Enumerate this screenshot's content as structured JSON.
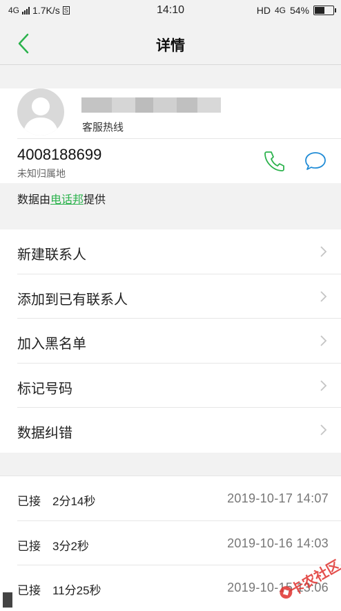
{
  "status_bar": {
    "network": "4G",
    "speed": "1.7K/s",
    "time": "14:10",
    "hd": "HD",
    "network_right": "4G",
    "battery": "54%",
    "battery_level": 0.54
  },
  "header": {
    "title": "详情"
  },
  "contact": {
    "subtitle": "客服热线",
    "number": "4008188699",
    "location": "未知归属地"
  },
  "source": {
    "prefix": "数据由",
    "link": "电话邦",
    "suffix": "提供"
  },
  "menu": {
    "items": [
      {
        "label": "新建联系人"
      },
      {
        "label": "添加到已有联系人"
      },
      {
        "label": "加入黑名单"
      },
      {
        "label": "标记号码"
      },
      {
        "label": "数据纠错"
      }
    ]
  },
  "call_log": [
    {
      "status": "已接",
      "duration": "2分14秒",
      "datetime": "2019-10-17  14:07"
    },
    {
      "status": "已接",
      "duration": "3分2秒",
      "datetime": "2019-10-16  14:03"
    },
    {
      "status": "已接",
      "duration": "11分25秒",
      "datetime": "2019-10-15  13:06"
    }
  ],
  "watermark": {
    "text": "卡农社区"
  },
  "colors": {
    "accent": "#2bb24c",
    "blue": "#1f8bd6",
    "background": "#f2f2f2"
  }
}
